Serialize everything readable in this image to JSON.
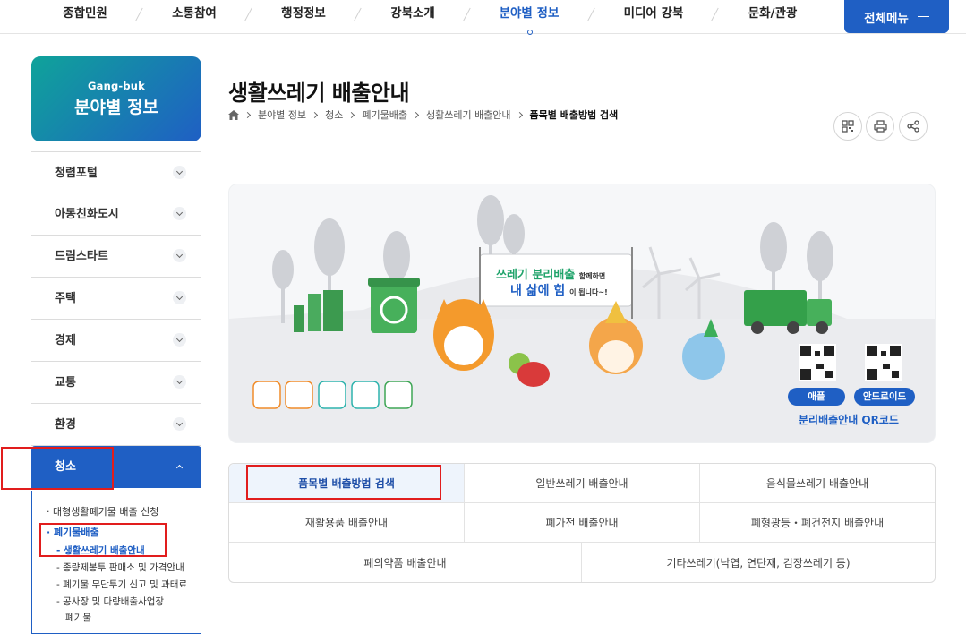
{
  "topnav": {
    "items": [
      "종합민원",
      "소통참여",
      "행정정보",
      "강북소개",
      "분야별 정보",
      "미디어 강북",
      "문화/관광"
    ],
    "active_index": 4,
    "all_menu_label": "전체메뉴"
  },
  "sidebar": {
    "banner_en": "Gang-buk",
    "banner_ko": "분야별 정보",
    "menu": [
      "청렴포털",
      "아동친화도시",
      "드림스타트",
      "주택",
      "경제",
      "교통",
      "환경",
      "청소"
    ],
    "open_index": 7,
    "sub": {
      "item1": "대형생활폐기물 배출 신청",
      "item2": "폐기물배출",
      "item2_children": [
        "생활쓰레기 배출안내",
        "종량제봉투 판매소 및 가격안내",
        "폐기물 무단투기 신고 및 과태료",
        "공사장 및 다량배출사업장",
        "폐기물"
      ]
    }
  },
  "header": {
    "title": "생활쓰레기 배출안내",
    "breadcrumb": [
      "분야별 정보",
      "청소",
      "폐기물배출",
      "생활쓰레기 배출안내",
      "품목별 배출방법 검색"
    ]
  },
  "illustration": {
    "banner_line1": "쓰레기 분리배출",
    "banner_line1_small": "함께하면",
    "banner_line2": "내 삶에 힘",
    "banner_line2_small": "이 됩니다~!",
    "apple_label": "애플",
    "android_label": "안드로이드",
    "qr_caption": "분리배출안내 QR코드"
  },
  "tabs": {
    "row1": [
      "품목별 배출방법 검색",
      "일반쓰레기 배출안내",
      "음식물쓰레기 배출안내"
    ],
    "row2": [
      "재활용품 배출안내",
      "폐가전 배출안내",
      "폐형광등・폐건전지 배출안내"
    ],
    "row3": [
      "폐의약품 배출안내",
      "기타쓰레기(낙엽, 연탄재, 김장쓰레기 등)"
    ],
    "selected": "품목별 배출방법 검색"
  },
  "colors": {
    "primary": "#1f5fc4",
    "teal": "#0fa39a",
    "highlight": "#e11d1d"
  }
}
